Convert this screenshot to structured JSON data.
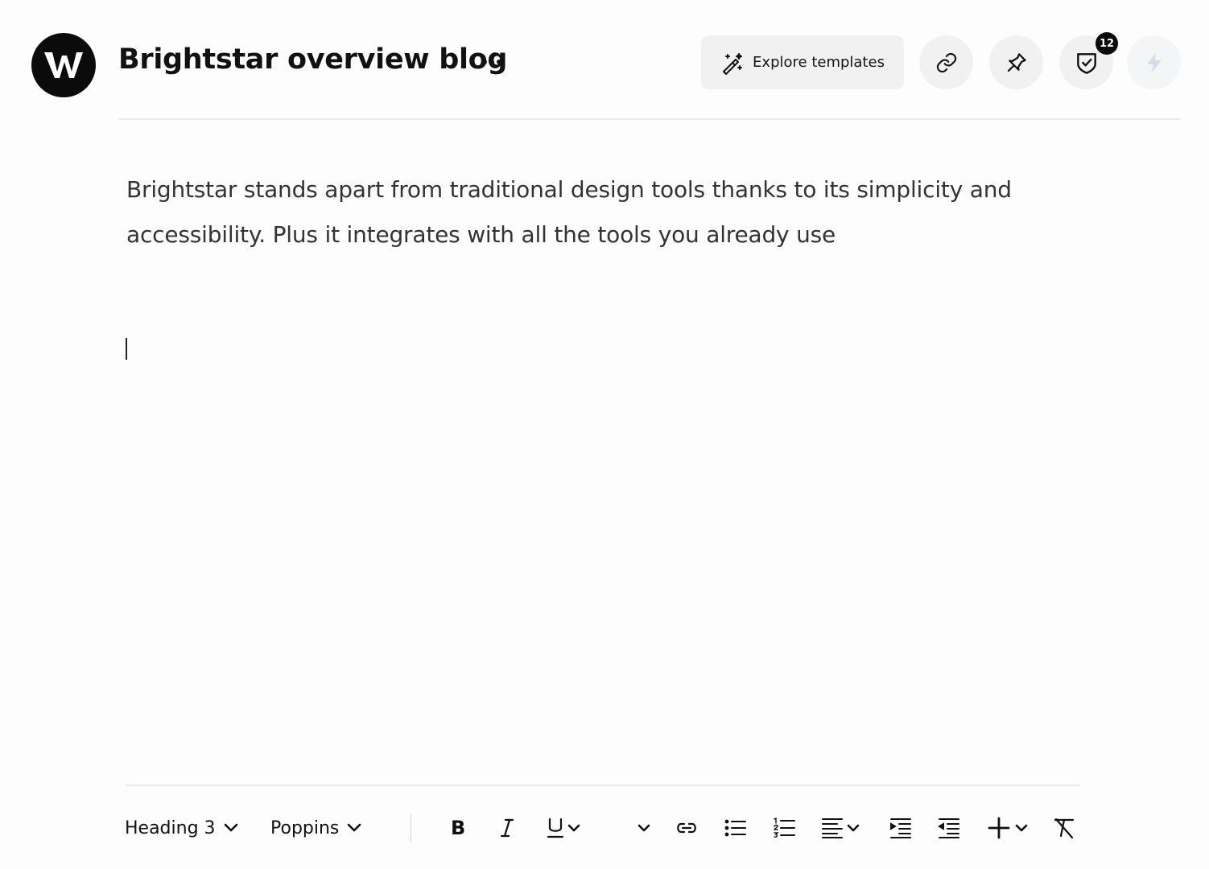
{
  "header": {
    "logo_letter": "W",
    "doc_title": "Brightstar overview blog",
    "more_icon": "more-horizontal-icon",
    "explore_label": "Explore templates",
    "badge_count": "12"
  },
  "editor": {
    "paragraph": "Brightstar stands apart from traditional design tools thanks to its simplicity and accessibility. Plus it integrates with all the tools you already use"
  },
  "toolbar": {
    "text_style": "Heading 3",
    "font": "Poppins",
    "bold_glyph": "B",
    "italic_glyph": "I",
    "underline_glyph": "U"
  },
  "colors": {
    "accent": "#0b0b0b",
    "button_bg": "#f1f1f2",
    "disabled_icon": "#d4dde8"
  }
}
